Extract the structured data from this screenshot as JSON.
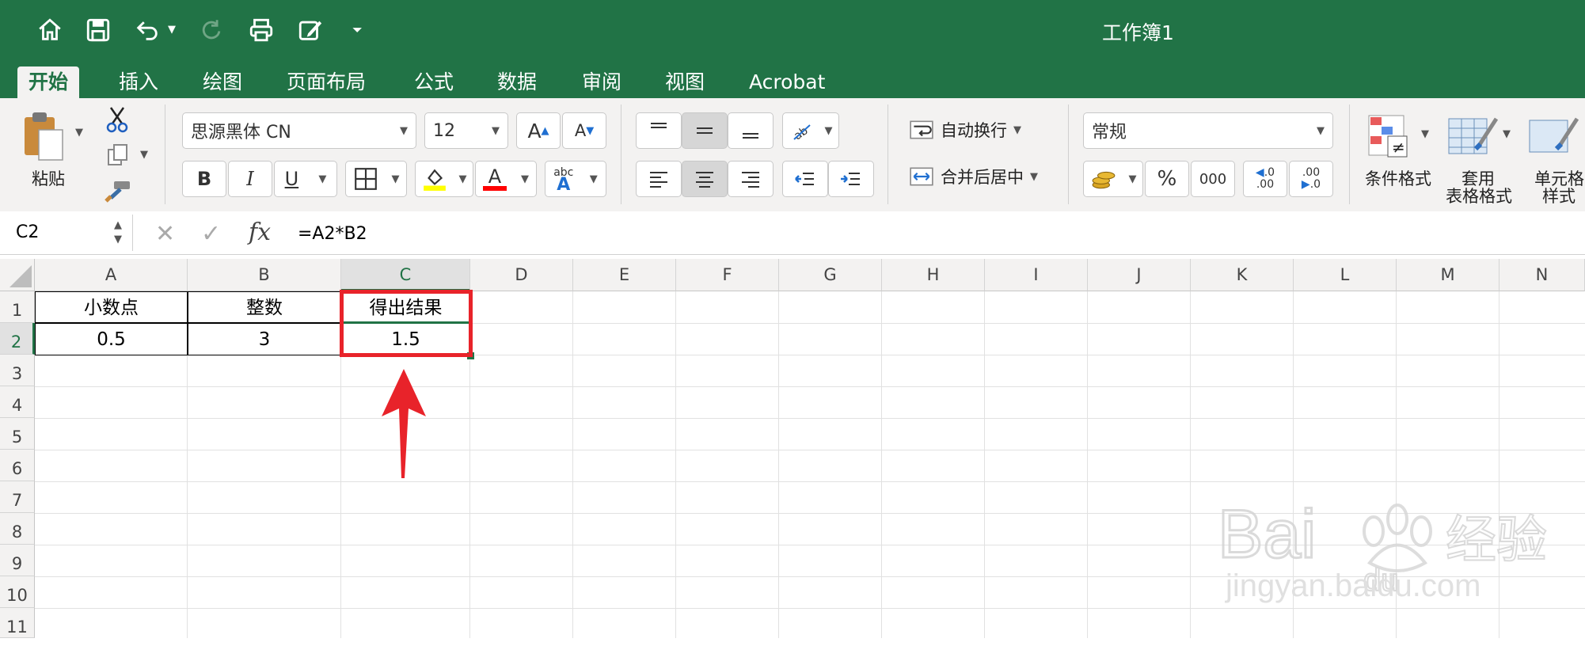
{
  "window": {
    "title": "工作簿1"
  },
  "tabs": [
    {
      "label": "开始",
      "active": true
    },
    {
      "label": "插入"
    },
    {
      "label": "绘图"
    },
    {
      "label": "页面布局"
    },
    {
      "label": "公式"
    },
    {
      "label": "数据"
    },
    {
      "label": "审阅"
    },
    {
      "label": "视图"
    },
    {
      "label": "Acrobat"
    }
  ],
  "ribbon": {
    "paste_label": "粘贴",
    "font_name": "思源黑体 CN",
    "font_size": "12",
    "grow_font": "A",
    "shrink_font": "A",
    "bold": "B",
    "italic": "I",
    "underline": "U",
    "font_color_letter": "A",
    "abc": "abc",
    "abc_a": "A",
    "wrap_text": "自动换行",
    "merge_center": "合并后居中",
    "number_format": "常规",
    "percent": "%",
    "thousands": "000",
    "inc_decimal_top": ".0",
    "inc_decimal_bottom": ".00",
    "dec_decimal_top": ".00",
    "dec_decimal_bottom": ".0",
    "conditional_format": "条件格式",
    "table_format_1": "套用",
    "table_format_2": "表格格式",
    "cell_style_1": "单元格",
    "cell_style_2": "样式",
    "highlight_color": "#ffff00",
    "font_color": "#ff0000"
  },
  "formula_bar": {
    "name_box": "C2",
    "fx": "fx",
    "formula": "=A2*B2"
  },
  "columns": [
    "A",
    "B",
    "C",
    "D",
    "E",
    "F",
    "G",
    "H",
    "I",
    "J",
    "K",
    "L",
    "M",
    "N"
  ],
  "rows": [
    "1",
    "2",
    "3",
    "4",
    "5",
    "6",
    "7",
    "8",
    "9",
    "10",
    "11"
  ],
  "cells": {
    "A1": "小数点",
    "B1": "整数",
    "C1": "得出结果",
    "A2": "0.5",
    "B2": "3",
    "C2": "1.5"
  },
  "watermark": {
    "logo": "Bai du 经验",
    "url": "jingyan.baidu.com"
  },
  "colors": {
    "accent": "#217346",
    "highlight_box": "#e8232a",
    "arrow": "#e8232a"
  }
}
